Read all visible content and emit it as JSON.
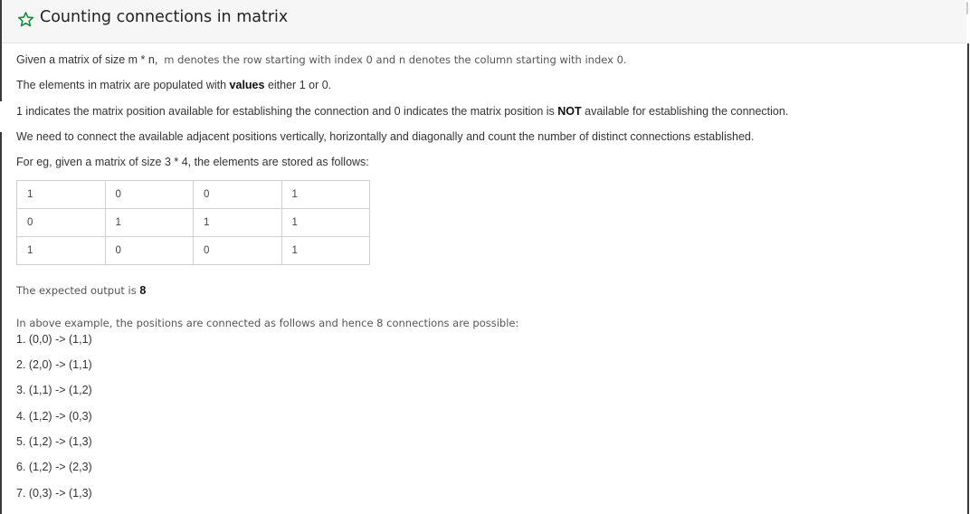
{
  "header": {
    "title": "Counting connections in matrix",
    "favorite_icon": "star-outline-icon",
    "accent_color": "#1a8a3c"
  },
  "intro": {
    "p1_main": "Given a matrix of size m * n,",
    "p1_note": "m denotes the row starting with index 0 and n denotes the column starting with index 0.",
    "p2_before": "The elements in matrix are populated with",
    "p2_bold": "values",
    "p2_after": "either 1 or 0.",
    "p3_before": "1 indicates the matrix position available for establishing the connection and 0 indicates the matrix position is",
    "p3_bold": "NOT",
    "p3_after": "available for establishing the connection.",
    "p4": "We need to connect the available adjacent positions vertically, horizontally and diagonally and count the number of distinct connections established.",
    "p5": "For eg, given a matrix of size 3 * 4, the elements are stored as follows:"
  },
  "matrix": {
    "rows": [
      [
        "1",
        "0",
        "0",
        "1"
      ],
      [
        "0",
        "1",
        "1",
        "1"
      ],
      [
        "1",
        "0",
        "0",
        "1"
      ]
    ]
  },
  "expected": {
    "label": "The expected output is",
    "value": "8"
  },
  "explanation": {
    "intro": "In above example, the positions are connected as follows and hence 8 connections are possible:",
    "connections": [
      "1. (0,0) -> (1,1)",
      "2. (2,0) -> (1,1)",
      "3. (1,1) -> (1,2)",
      "4. (1,2) -> (0,3)",
      "5. (1,2) -> (1,3)",
      "6. (1,2) -> (2,3)",
      "7. (0,3) -> (1,3)"
    ]
  }
}
